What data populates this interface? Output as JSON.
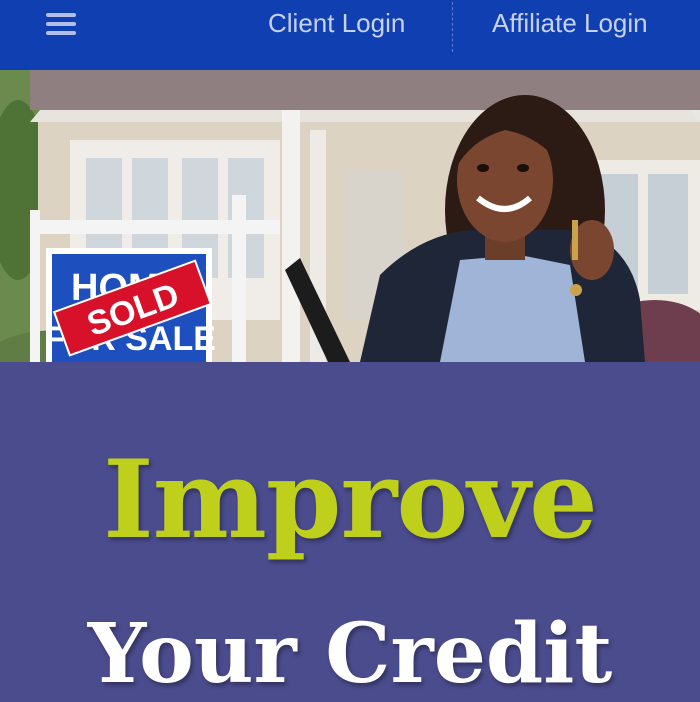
{
  "header": {
    "menu_icon": "hamburger-menu-icon",
    "links": [
      {
        "label": "Client Login"
      },
      {
        "label": "Affiliate Login"
      }
    ]
  },
  "hero": {
    "sign": {
      "top_text": "HOME",
      "bottom_text": "FOR SALE",
      "stamp_text": "SOLD"
    }
  },
  "headline": {
    "primary": "Improve",
    "secondary": "Your Credit"
  },
  "colors": {
    "header_bg": "#0f3fb0",
    "body_bg": "#4b4c8e",
    "headline_primary": "#bed01c",
    "headline_secondary": "#ffffff"
  }
}
